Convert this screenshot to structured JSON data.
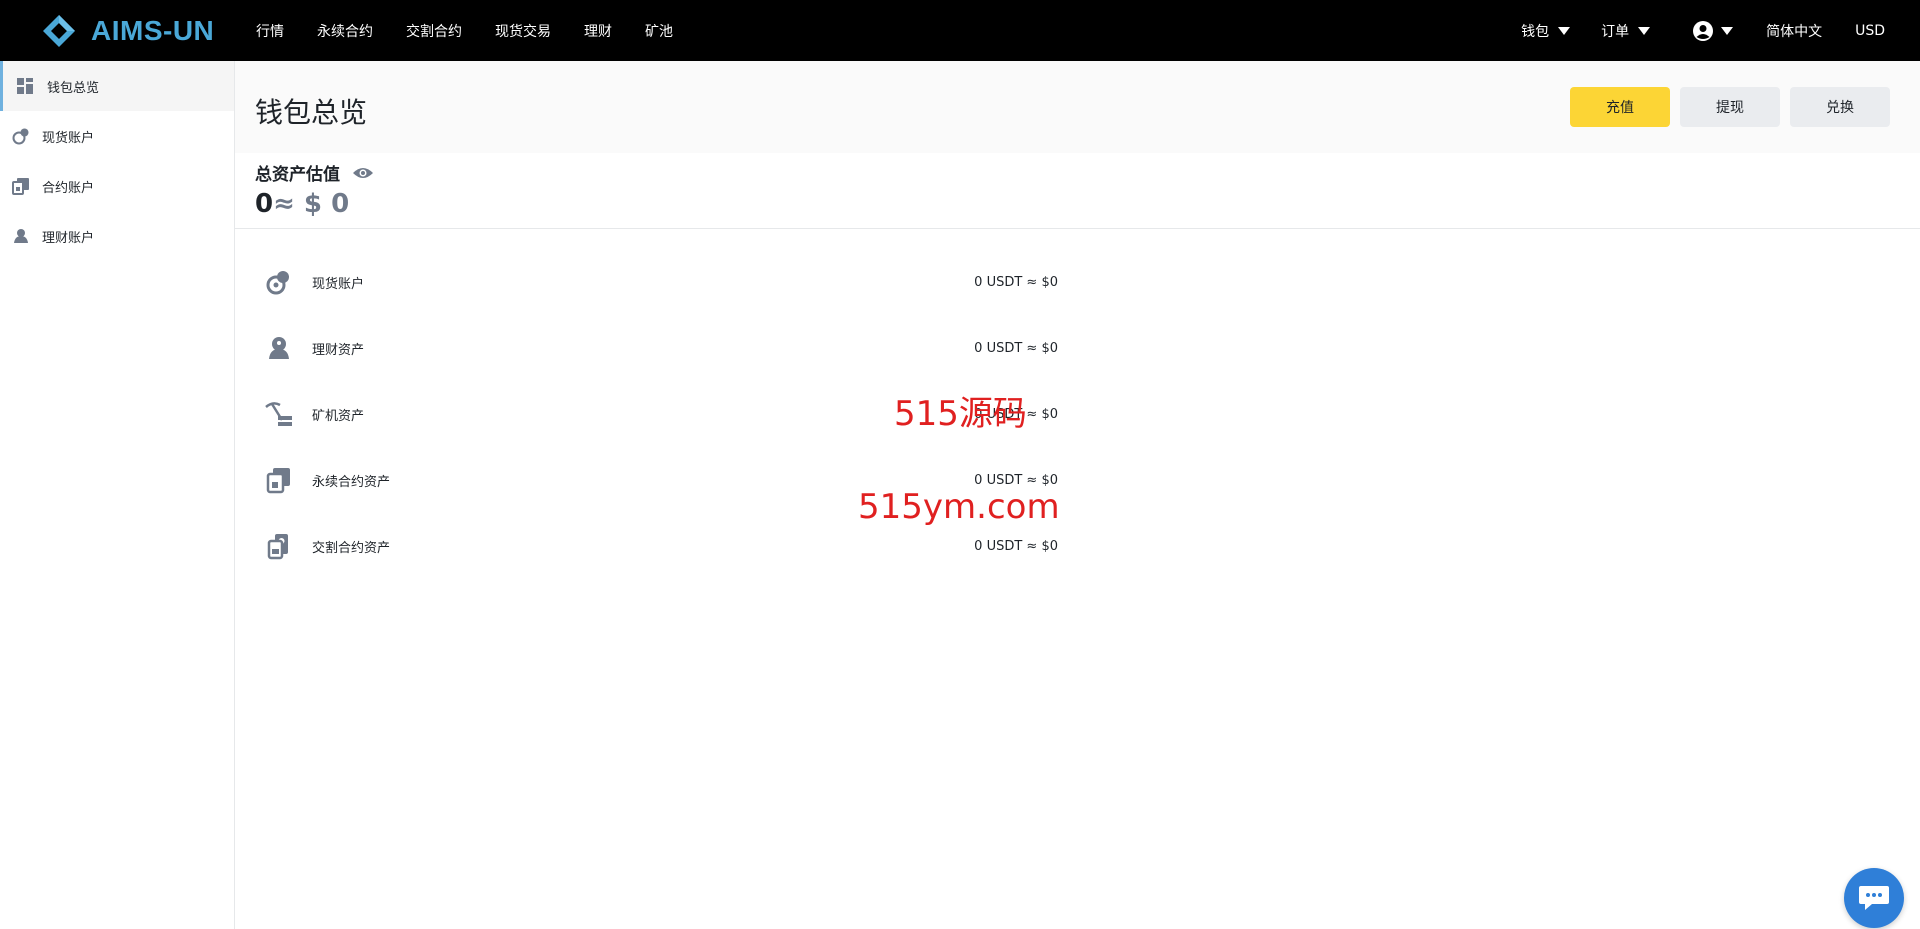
{
  "brand": {
    "name": "AIMS-UN",
    "color": "#4aa8d8"
  },
  "nav": {
    "items": [
      "行情",
      "永续合约",
      "交割合约",
      "现货交易",
      "理财",
      "矿池"
    ],
    "wallet_label": "钱包",
    "orders_label": "订单",
    "language_label": "简体中文",
    "currency_label": "USD"
  },
  "sidebar": {
    "items": [
      {
        "label": "钱包总览",
        "icon": "dashboard-icon",
        "active": true
      },
      {
        "label": "现货账户",
        "icon": "spot-account-icon"
      },
      {
        "label": "合约账户",
        "icon": "contract-account-icon"
      },
      {
        "label": "理财账户",
        "icon": "finance-account-icon"
      }
    ]
  },
  "header": {
    "title": "钱包总览",
    "deposit_label": "充值",
    "withdraw_label": "提现",
    "exchange_label": "兑换"
  },
  "total": {
    "label": "总资产估值",
    "value": "0",
    "approx": "≈ $ 0"
  },
  "assets": [
    {
      "name": "现货账户",
      "value": "0 USDT ≈ $0",
      "icon": "spot-icon"
    },
    {
      "name": "理财资产",
      "value": "0 USDT ≈ $0",
      "icon": "piggy-icon"
    },
    {
      "name": "矿机资产",
      "value": "0 USDT ≈ $0",
      "icon": "mining-pickaxe-icon"
    },
    {
      "name": "永续合约资产",
      "value": "0 USDT ≈ $0",
      "icon": "perpetual-contract-icon"
    },
    {
      "name": "交割合约资产",
      "value": "0 USDT ≈ $0",
      "icon": "delivery-contract-icon"
    }
  ],
  "watermark": {
    "line1": "515源码",
    "line2": "515ym.com"
  },
  "colors": {
    "accent": "#fcd535",
    "active_border": "#6fb1df",
    "icon_gray": "#707a8a",
    "watermark": "#e02020"
  }
}
